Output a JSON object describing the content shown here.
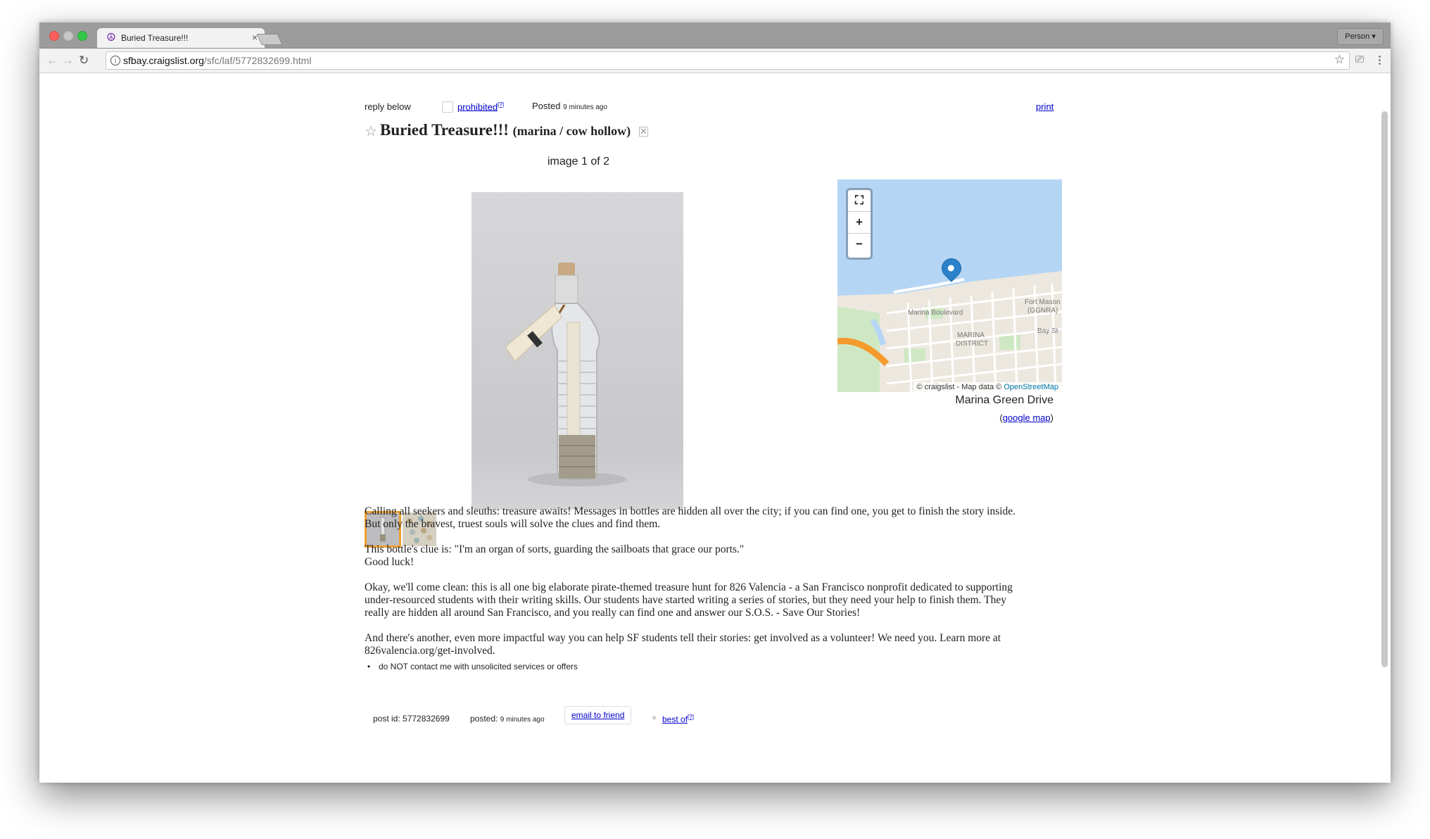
{
  "browser": {
    "tab_title": "Buried Treasure!!!",
    "tab_close": "×",
    "profile_label": "Person ▾",
    "url_host": "sfbay.craigslist.org",
    "url_path": "/sfc/laf/5772832699.html",
    "icons": {
      "favicon": "peace-icon",
      "back": "back-arrow-icon",
      "forward": "forward-arrow-icon",
      "reload": "reload-icon",
      "info": "info-icon",
      "bookmark": "star-icon",
      "cast": "cast-icon",
      "menu": "kebab-menu-icon"
    }
  },
  "post": {
    "reply_label": "reply below",
    "prohibited_label": "prohibited",
    "prohibited_sup": "[?]",
    "posted_label": "Posted",
    "posted_time": "9 minutes ago",
    "print_label": "print",
    "title": "Buried Treasure!!!",
    "neighborhood": "(marina / cow hollow)",
    "image_caption": "image 1 of 2",
    "map": {
      "zoom_in": "+",
      "zoom_out": "−",
      "attribution_prefix": "© craigslist - Map data ©",
      "attribution_link": "OpenStreetMap",
      "labels": {
        "boulevard": "Marina Boulevard",
        "district_1": "MARINA",
        "district_2": "DISTRICT",
        "fort_1": "Fort Mason",
        "fort_2": "(GGNRA)",
        "bay": "Bay St"
      },
      "address": "Marina Green Drive",
      "google_map_label": "google map"
    },
    "body_paragraphs": [
      [
        "Calling all seekers and sleuths: treasure awaits! Messages in bottles are hidden all over the city; if you can find one, you get to finish the story inside.",
        "But only the bravest, truest souls will solve the clues and find them."
      ],
      [
        "This bottle's clue is: \"I'm an organ of sorts, guarding the sailboats that grace our ports.\"",
        "Good luck!"
      ],
      [
        "Okay, we'll come clean: this is all one big elaborate pirate-themed treasure hunt for 826 Valencia - a San Francisco nonprofit dedicated to supporting",
        "under-resourced students with their writing skills. Our students have started writing a series of stories, but they need your help to finish them. They",
        "really are hidden all around San Francisco, and you really can find one and answer our S.O.S. - Save Our Stories!"
      ],
      [
        "And there's another, even more impactful way you can help SF students tell their stories: get involved as a volunteer! We need you. Learn more at",
        "826valencia.org/get-involved."
      ]
    ],
    "notice": "do NOT contact me with unsolicited services or offers",
    "footer": {
      "post_id": "post id: 5772832699",
      "posted_label": "posted:",
      "posted_time": "9 minutes ago",
      "email_label": "email to friend",
      "best_of_label": "best of",
      "best_of_sup": "[?]"
    }
  }
}
